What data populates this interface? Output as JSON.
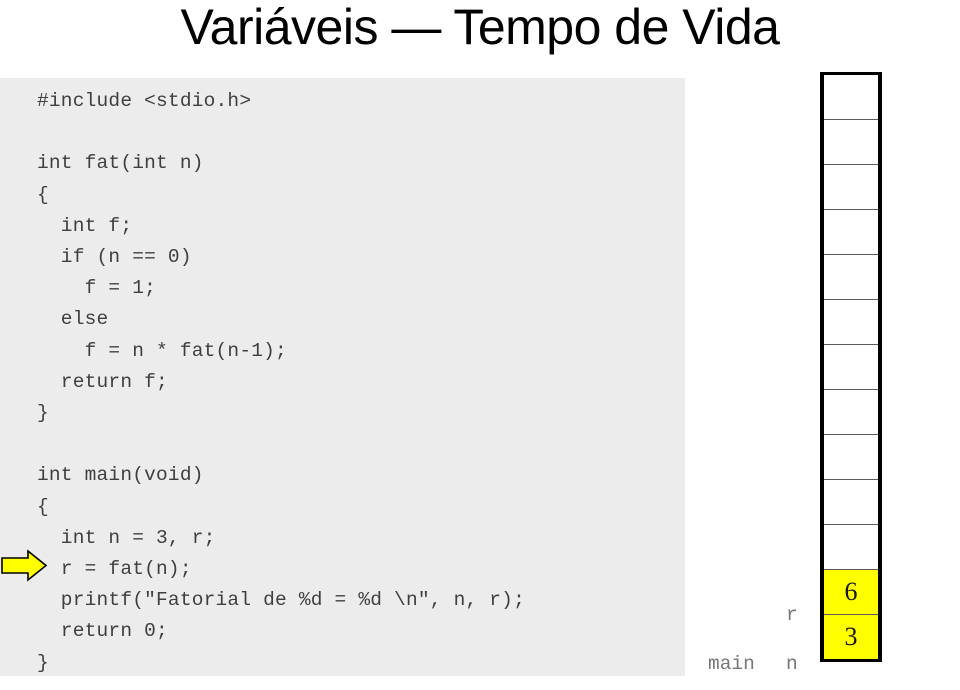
{
  "slide": {
    "title": "Variáveis — Tempo de Vida",
    "background_color": "#ffffff"
  },
  "code_panel": {
    "background_color": "#ececec",
    "text_color": "#3f3f3f",
    "language": "c",
    "lines": [
      "#include <stdio.h>",
      "",
      "int fat(int n)",
      "{",
      "  int f;",
      "  if (n == 0)",
      "    f = 1;",
      "  else",
      "    f = n * fat(n-1);",
      "  return f;",
      "}",
      "",
      "int main(void)",
      "{",
      "  int n = 3, r;",
      "  r = fat(n);",
      "  printf(\"Fatorial de %d = %d \\n\", n, r);",
      "  return 0;",
      "}"
    ],
    "source": "#include <stdio.h>\n\nint fat(int n)\n{\n  int f;\n  if (n == 0)\n    f = 1;\n  else\n    f = n * fat(n-1);\n  return f;\n}\n\nint main(void)\n{\n  int n = 3, r;\n  r = fat(n);\n  printf(\"Fatorial de %d = %d \\n\", n, r);\n  return 0;\n}"
  },
  "execution_pointer": {
    "icon": "right-arrow-icon",
    "fill_color": "#ffff00",
    "outline_color": "#000000",
    "points_at_line": "r = fat(n);"
  },
  "memory_stack": {
    "outline_color": "#000000",
    "divider_color": "#5a5a5a",
    "filled_color": "#ffff00",
    "empty_color": "#ffffff",
    "cells": [
      {
        "value": "",
        "filled": false
      },
      {
        "value": "",
        "filled": false
      },
      {
        "value": "",
        "filled": false
      },
      {
        "value": "",
        "filled": false
      },
      {
        "value": "",
        "filled": false
      },
      {
        "value": "",
        "filled": false
      },
      {
        "value": "",
        "filled": false
      },
      {
        "value": "",
        "filled": false
      },
      {
        "value": "",
        "filled": false
      },
      {
        "value": "",
        "filled": false
      },
      {
        "value": "",
        "filled": false
      },
      {
        "value": "6",
        "filled": true
      },
      {
        "value": "3",
        "filled": true
      }
    ],
    "labels": {
      "frame": "main",
      "variable_r": "r",
      "variable_n": "n",
      "text_color": "#777777"
    }
  }
}
